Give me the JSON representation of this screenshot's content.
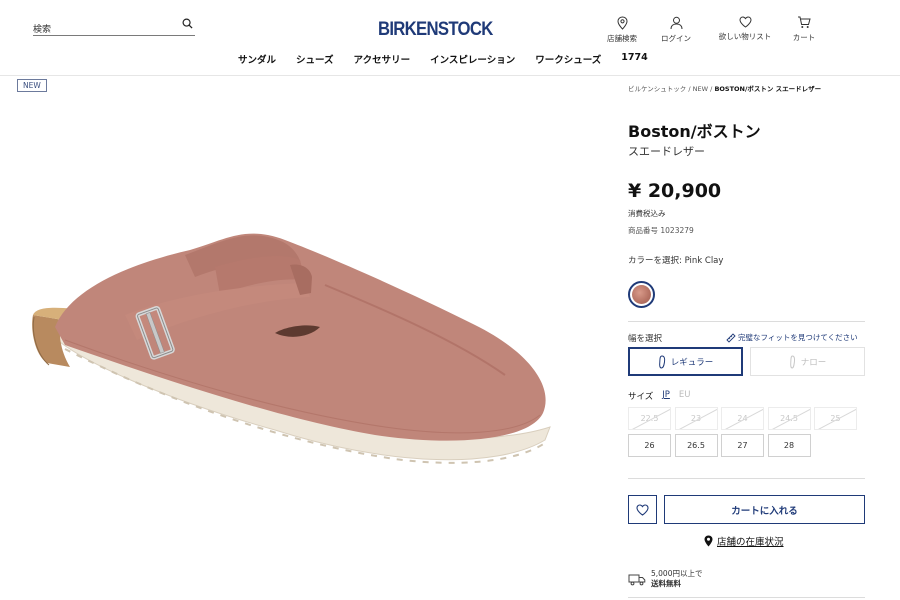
{
  "header": {
    "search_placeholder": "検索",
    "logo": "BIRKENSTOCK",
    "icons": [
      {
        "label": "店舗検索",
        "icon": "location-pin-icon"
      },
      {
        "label": "ログイン",
        "icon": "user-icon"
      },
      {
        "label": "欲しい物リスト",
        "icon": "heart-icon"
      },
      {
        "label": "カート",
        "icon": "cart-icon"
      }
    ],
    "nav": [
      "サンダル",
      "シューズ",
      "アクセサリー",
      "インスピレーション",
      "ワークシューズ",
      "1774"
    ]
  },
  "gallery": {
    "badge": "NEW"
  },
  "product": {
    "breadcrumb": {
      "home": "ビルケンシュトック",
      "sep": "/",
      "category": "NEW",
      "current": "BOSTON/ボストン スエードレザー"
    },
    "title": "Boston/ボストン",
    "subtitle": "スエードレザー",
    "price": "¥ 20,900",
    "tax_note": "消費税込み",
    "sku_label": "商品番号",
    "sku": "1023279",
    "color_label": "カラーを選択:",
    "color_value": "Pink Clay",
    "swatch_color": "#b87566",
    "width_label": "幅を選択",
    "fit_link": "完璧なフィットを見つけてください",
    "width_options": [
      "レギュラー",
      "ナロー"
    ],
    "size_label": "サイズ",
    "size_systems": [
      "JP",
      "EU"
    ],
    "sizes_unavailable": [
      "22.5",
      "23",
      "24",
      "24.5",
      "25"
    ],
    "sizes_available": [
      "26",
      "26.5",
      "27",
      "28"
    ],
    "add_to_cart": "カートに入れる",
    "store_stock": "店舗の在庫状況",
    "shipping_line1": "5,000円以上で",
    "shipping_line2": "送料無料",
    "accent_color": "#1f3a78"
  }
}
